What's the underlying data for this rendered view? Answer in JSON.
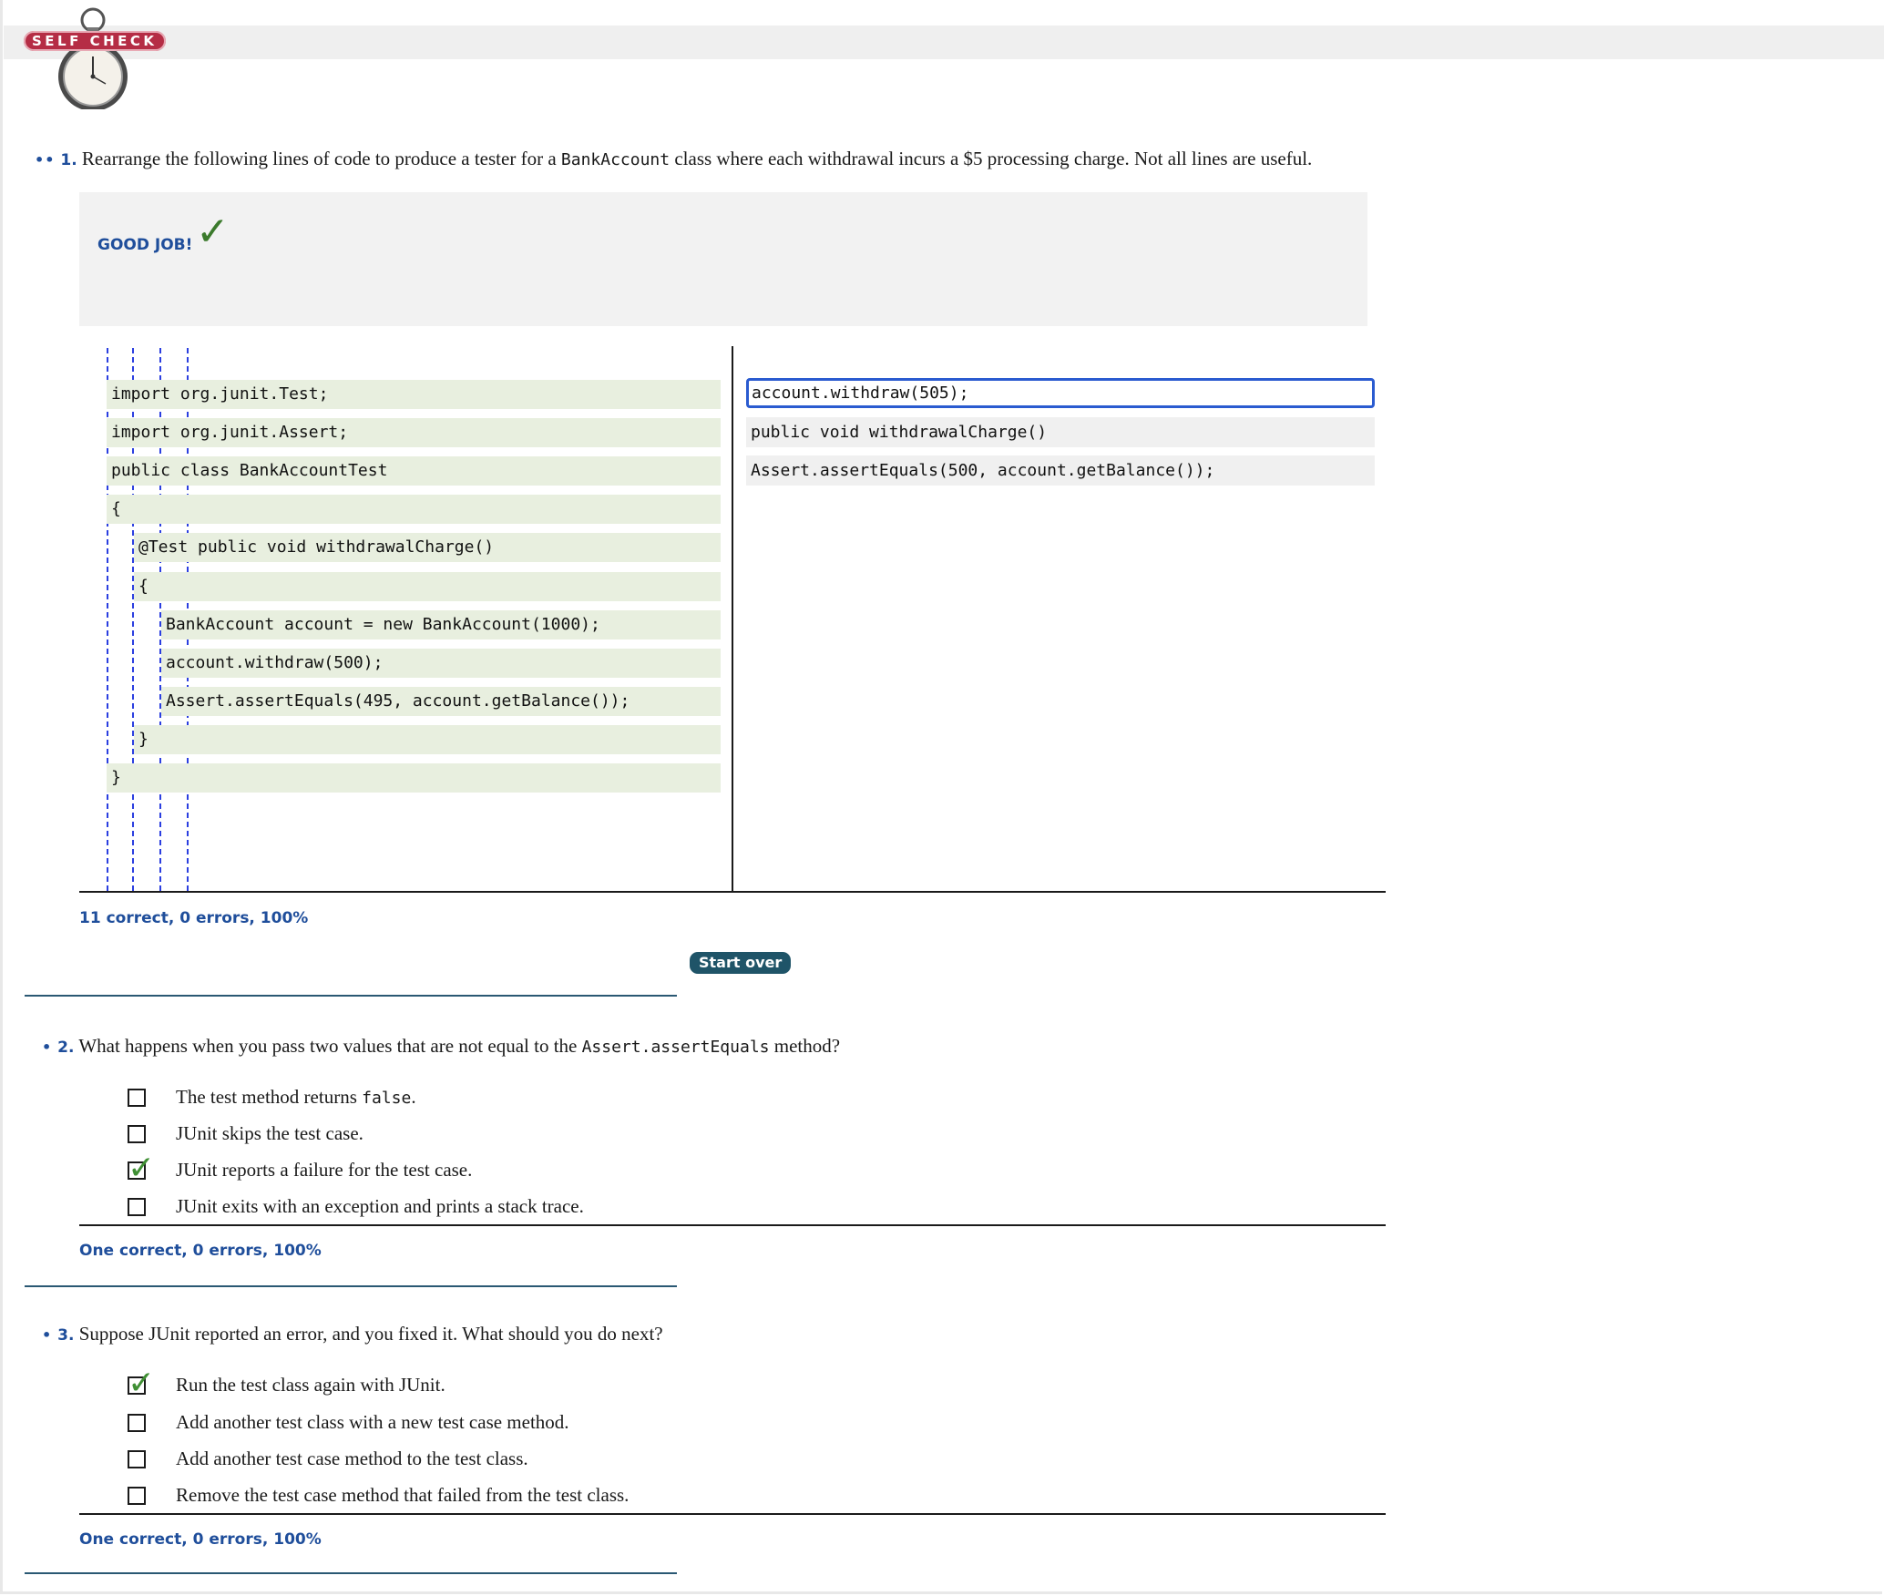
{
  "header": {
    "badge_label": "SELF CHECK"
  },
  "q1": {
    "dots": "••",
    "number": "1.",
    "text_before": "Rearrange the following lines of code to produce a tester for a ",
    "code": "BankAccount",
    "text_after": " class where each withdrawal incurs a $5 processing charge. Not all lines are useful.",
    "feedback": "GOOD JOB!",
    "feedback_mark": "✓",
    "placed_lines": [
      "import org.junit.Test;",
      "import org.junit.Assert;",
      "public class BankAccountTest",
      "{",
      "@Test public void withdrawalCharge()",
      "{",
      "BankAccount account = new BankAccount(1000);",
      "account.withdraw(500);",
      "Assert.assertEquals(495, account.getBalance());",
      "}",
      "}"
    ],
    "unused_tiles": [
      "account.withdraw(505);",
      "public void withdrawalCharge()",
      "Assert.assertEquals(500, account.getBalance());"
    ],
    "score": "11 correct, 0 errors, 100%",
    "start_over_label": "Start over"
  },
  "q2": {
    "dots": "•",
    "number": "2.",
    "text_before": "What happens when you pass two values that are not equal to the ",
    "code": "Assert.assertEquals",
    "text_after": " method?",
    "choices": {
      "c1_before": "The test method returns ",
      "c1_code": "false",
      "c1_after": ".",
      "c2": "JUnit skips the test case.",
      "c3": "JUnit reports a failure for the test case.",
      "c4": "JUnit exits with an exception and prints a stack trace."
    },
    "score": "One correct, 0 errors, 100%"
  },
  "q3": {
    "dots": "•",
    "number": "3.",
    "text": "Suppose JUnit reported an error, and you fixed it. What should you do next?",
    "choices": [
      "Run the test class again with JUnit.",
      "Add another test class with a new test case method.",
      "Add another test case method to the test class.",
      "Remove the test case method that failed from the test class."
    ],
    "score": "One correct, 0 errors, 100%"
  },
  "icons": {
    "check": "✓",
    "checked_box": "checkmark-icon",
    "stopwatch": "stopwatch-icon"
  },
  "colors": {
    "accent_blue": "#1f4e9b",
    "badge_red": "#b52d45",
    "code_line_bg": "#e8efdf",
    "check_green": "#3f8f34",
    "button": "#1f5468"
  }
}
